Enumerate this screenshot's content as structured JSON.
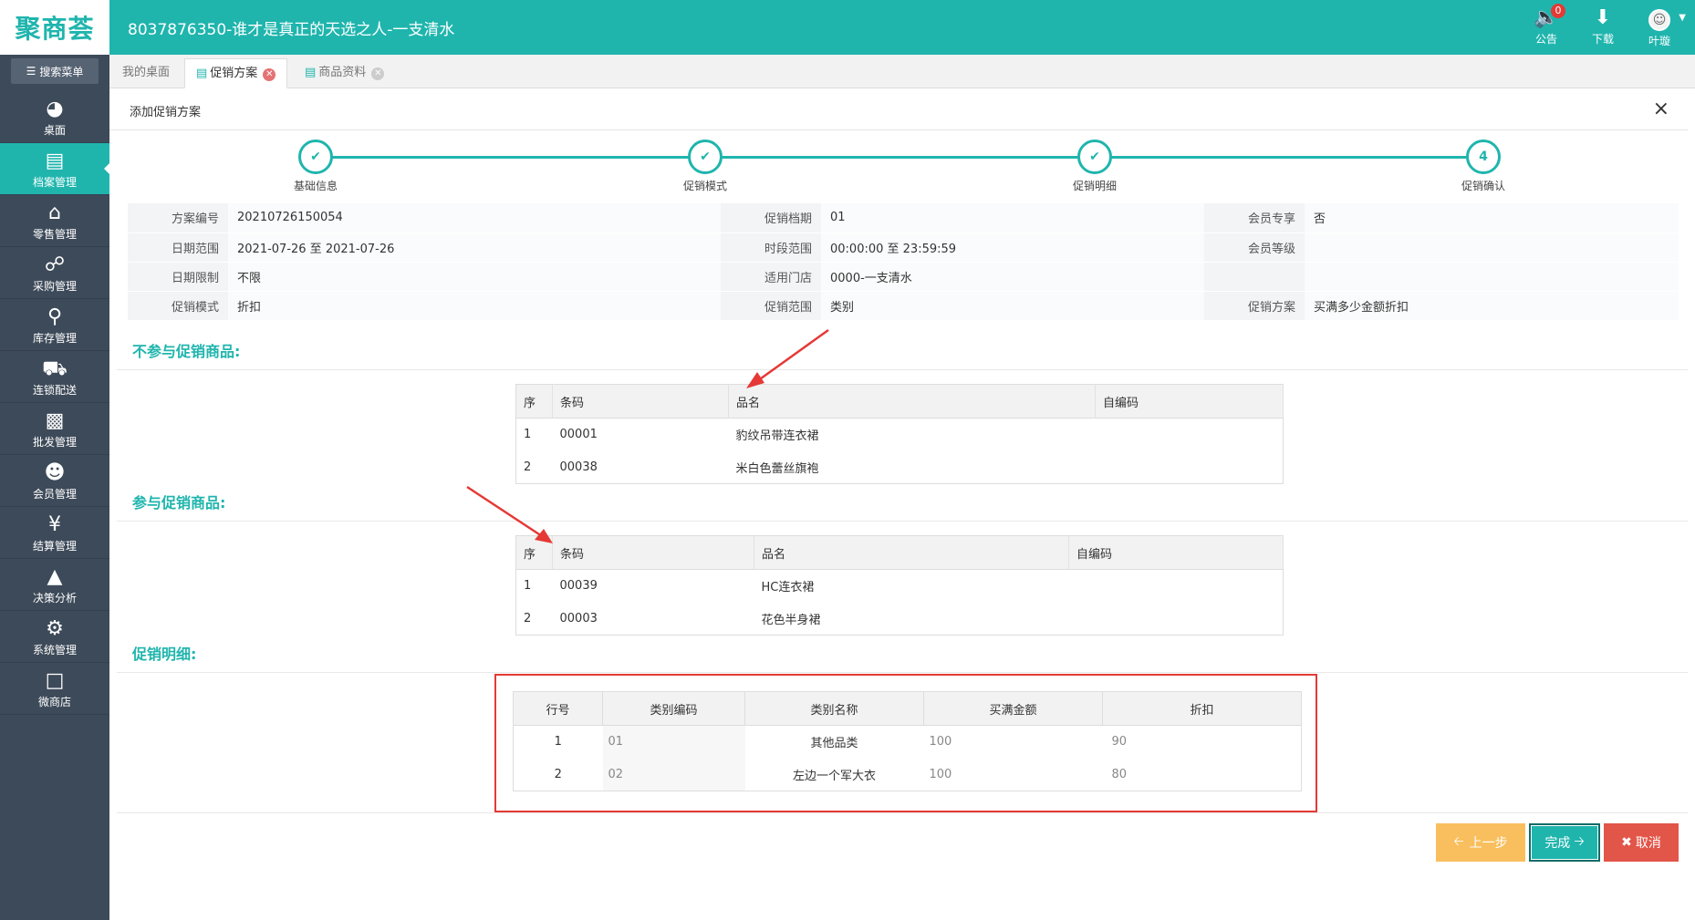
{
  "header": {
    "logo": "聚商荟",
    "store_title": "8037876350-谁才是真正的天选之人-一支清水",
    "tools": [
      {
        "icon": "speaker-icon",
        "label": "公告",
        "badge": "0"
      },
      {
        "icon": "download-icon",
        "label": "下载"
      },
      {
        "icon": "user-avatar",
        "label": "叶璇"
      }
    ]
  },
  "sidebar": {
    "search_label": "搜索菜单",
    "items": [
      {
        "label": "桌面",
        "icon": "dashboard-icon"
      },
      {
        "label": "档案管理",
        "icon": "file-icon",
        "active": true
      },
      {
        "label": "零售管理",
        "icon": "store-icon"
      },
      {
        "label": "采购管理",
        "icon": "cart-icon"
      },
      {
        "label": "库存管理",
        "icon": "inventory-search-icon"
      },
      {
        "label": "连锁配送",
        "icon": "truck-icon"
      },
      {
        "label": "批发管理",
        "icon": "wholesale-icon"
      },
      {
        "label": "会员管理",
        "icon": "member-icon"
      },
      {
        "label": "结算管理",
        "icon": "yuan-icon"
      },
      {
        "label": "决策分析",
        "icon": "chart-icon"
      },
      {
        "label": "系统管理",
        "icon": "gear-icon"
      },
      {
        "label": "微商店",
        "icon": "bag-icon"
      }
    ]
  },
  "tabs": [
    {
      "label": "我的桌面"
    },
    {
      "label": "促销方案",
      "active": true
    },
    {
      "label": "商品资料"
    }
  ],
  "panel": {
    "title": "添加促销方案",
    "close": "×"
  },
  "steps": [
    {
      "label": "基础信息",
      "mark": "✔"
    },
    {
      "label": "促销模式",
      "mark": "✔"
    },
    {
      "label": "促销明细",
      "mark": "✔"
    },
    {
      "label": "促销确认",
      "mark": "4"
    }
  ],
  "info": {
    "rows": [
      [
        {
          "k": "方案编号",
          "v": "20210726150054"
        },
        {
          "k": "促销档期",
          "v": "01"
        },
        {
          "k": "会员专享",
          "v": "否"
        }
      ],
      [
        {
          "k": "日期范围",
          "v": "2021-07-26 至 2021-07-26"
        },
        {
          "k": "时段范围",
          "v": "00:00:00 至 23:59:59"
        },
        {
          "k": "会员等级",
          "v": ""
        }
      ],
      [
        {
          "k": "日期限制",
          "v": "不限"
        },
        {
          "k": "适用门店",
          "v": "0000-一支清水"
        },
        {
          "k": "",
          "v": ""
        }
      ],
      [
        {
          "k": "促销模式",
          "v": "折扣"
        },
        {
          "k": "促销范围",
          "v": "类别"
        },
        {
          "k": "促销方案",
          "v": "买满多少金额折扣"
        }
      ]
    ]
  },
  "excluded": {
    "title": "不参与促销商品:",
    "headers": [
      "序",
      "条码",
      "品名",
      "自编码"
    ],
    "rows": [
      [
        "1",
        "00001",
        "豹纹吊带连衣裙",
        ""
      ],
      [
        "2",
        "00038",
        "米白色蕾丝旗袍",
        ""
      ]
    ]
  },
  "included": {
    "title": "参与促销商品:",
    "headers": [
      "序",
      "条码",
      "品名",
      "自编码"
    ],
    "rows": [
      [
        "1",
        "00039",
        "HC连衣裙",
        ""
      ],
      [
        "2",
        "00003",
        "花色半身裙",
        ""
      ]
    ]
  },
  "details": {
    "title": "促销明细:",
    "headers": [
      "行号",
      "类别编码",
      "类别名称",
      "买满金额",
      "折扣"
    ],
    "rows": [
      [
        "1",
        "01",
        "其他品类",
        "100",
        "90"
      ],
      [
        "2",
        "02",
        "左边一个军大衣",
        "100",
        "80"
      ]
    ]
  },
  "buttons": {
    "prev": "上一步",
    "done": "完成",
    "cancel": "取消"
  },
  "colors": {
    "accent": "#1fb5ad",
    "sidebar": "#3d4a59",
    "annotation_red": "#e53935"
  }
}
